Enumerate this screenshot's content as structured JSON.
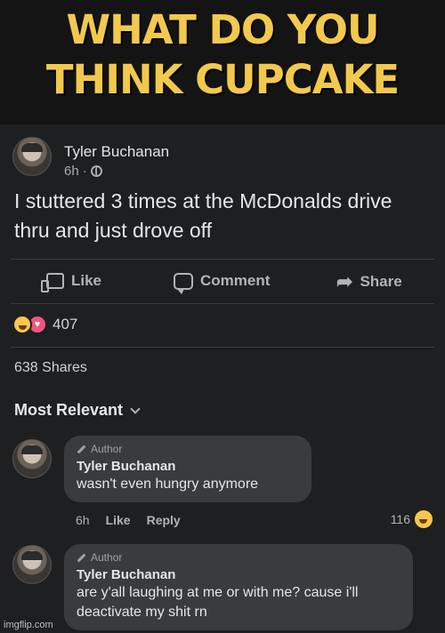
{
  "caption": {
    "line1": "WHAT DO YOU",
    "line2": "THINK CUPCAKE"
  },
  "post": {
    "author": "Tyler Buchanan",
    "time": "6h",
    "separator": "·",
    "text": "I stuttered 3 times at the McDonalds drive thru and just drove off",
    "actions": {
      "like": "Like",
      "comment": "Comment",
      "share": "Share"
    },
    "reaction_count": "407",
    "shares": "638 Shares",
    "sort_label": "Most Relevant"
  },
  "comments": [
    {
      "tag": "Author",
      "name": "Tyler Buchanan",
      "text": "wasn't even hungry anymore",
      "time": "6h",
      "like": "Like",
      "reply": "Reply",
      "reaction_count": "116"
    },
    {
      "tag": "Author",
      "name": "Tyler Buchanan",
      "text": "are y'all laughing at me or with me? cause i'll deactivate my shit rn"
    }
  ],
  "watermark": "imgflip.com",
  "colors": {
    "caption": "#f2c94c",
    "background": "#1e1f20",
    "bubble": "#3a3b3c"
  }
}
